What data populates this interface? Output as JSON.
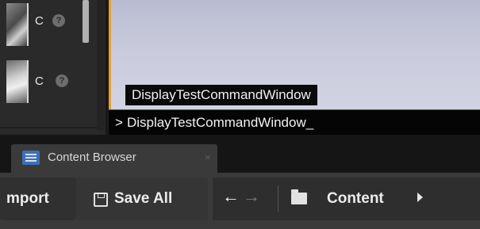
{
  "asset_list": {
    "items": [
      {
        "letter": "C",
        "icon": "help-icon"
      },
      {
        "letter": "C",
        "icon": "help-icon"
      }
    ]
  },
  "viewport": {
    "autocomplete_suggestion": "DisplayTestCommandWindow"
  },
  "console": {
    "prompt": ">",
    "input_value": "DisplayTestCommandWindow_"
  },
  "tabs": [
    {
      "label": "Content Browser",
      "icon": "content-browser-icon",
      "close_icon": "close-icon",
      "close_glyph": "×"
    }
  ],
  "toolbar": {
    "import_label": "mport",
    "save_all_label": "Save All",
    "back_glyph": "←",
    "forward_glyph": "→",
    "path_label": "Content"
  },
  "colors": {
    "viewport_accent": "#e3a03a",
    "tab_icon": "#3f6fb4"
  }
}
